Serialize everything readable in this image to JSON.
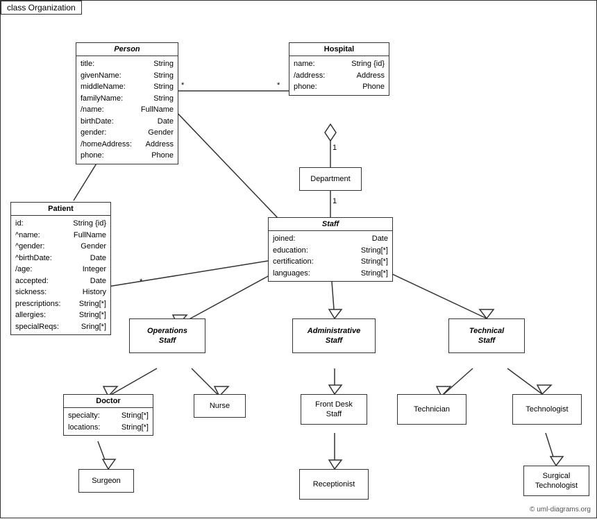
{
  "title": "class Organization",
  "classes": {
    "person": {
      "name": "Person",
      "italic": true,
      "attrs": [
        {
          "name": "title:",
          "type": "String"
        },
        {
          "name": "givenName:",
          "type": "String"
        },
        {
          "name": "middleName:",
          "type": "String"
        },
        {
          "name": "familyName:",
          "type": "String"
        },
        {
          "name": "/name:",
          "type": "FullName"
        },
        {
          "name": "birthDate:",
          "type": "Date"
        },
        {
          "name": "gender:",
          "type": "Gender"
        },
        {
          "name": "/homeAddress:",
          "type": "Address"
        },
        {
          "name": "phone:",
          "type": "Phone"
        }
      ]
    },
    "hospital": {
      "name": "Hospital",
      "italic": false,
      "attrs": [
        {
          "name": "name:",
          "type": "String {id}"
        },
        {
          "name": "/address:",
          "type": "Address"
        },
        {
          "name": "phone:",
          "type": "Phone"
        }
      ]
    },
    "patient": {
      "name": "Patient",
      "italic": false,
      "attrs": [
        {
          "name": "id:",
          "type": "String {id}"
        },
        {
          "name": "^name:",
          "type": "FullName"
        },
        {
          "name": "^gender:",
          "type": "Gender"
        },
        {
          "name": "^birthDate:",
          "type": "Date"
        },
        {
          "name": "/age:",
          "type": "Integer"
        },
        {
          "name": "accepted:",
          "type": "Date"
        },
        {
          "name": "sickness:",
          "type": "History"
        },
        {
          "name": "prescriptions:",
          "type": "String[*]"
        },
        {
          "name": "allergies:",
          "type": "String[*]"
        },
        {
          "name": "specialReqs:",
          "type": "Sring[*]"
        }
      ]
    },
    "department": {
      "name": "Department",
      "italic": false
    },
    "staff": {
      "name": "Staff",
      "italic": true,
      "attrs": [
        {
          "name": "joined:",
          "type": "Date"
        },
        {
          "name": "education:",
          "type": "String[*]"
        },
        {
          "name": "certification:",
          "type": "String[*]"
        },
        {
          "name": "languages:",
          "type": "String[*]"
        }
      ]
    },
    "operations_staff": {
      "name": "Operations\nStaff",
      "italic": true
    },
    "admin_staff": {
      "name": "Administrative\nStaff",
      "italic": true
    },
    "technical_staff": {
      "name": "Technical\nStaff",
      "italic": true
    },
    "doctor": {
      "name": "Doctor",
      "italic": false,
      "attrs": [
        {
          "name": "specialty:",
          "type": "String[*]"
        },
        {
          "name": "locations:",
          "type": "String[*]"
        }
      ]
    },
    "nurse": {
      "name": "Nurse",
      "italic": false
    },
    "front_desk_staff": {
      "name": "Front Desk\nStaff",
      "italic": false
    },
    "technician": {
      "name": "Technician",
      "italic": false
    },
    "technologist": {
      "name": "Technologist",
      "italic": false
    },
    "surgeon": {
      "name": "Surgeon",
      "italic": false
    },
    "receptionist": {
      "name": "Receptionist",
      "italic": false
    },
    "surgical_technologist": {
      "name": "Surgical\nTechnologist",
      "italic": false
    }
  },
  "multiplicity": {
    "star": "*",
    "one": "1"
  },
  "copyright": "© uml-diagrams.org"
}
